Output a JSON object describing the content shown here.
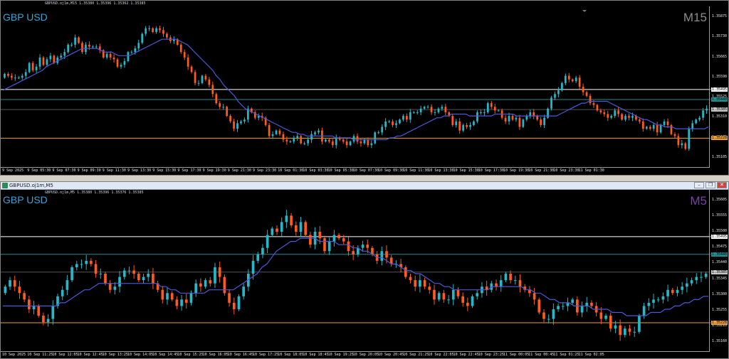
{
  "charts": [
    {
      "id": "m15",
      "window_title": "GBPUSD.oj1m,M15",
      "ohlc_text": "GBPUSD.oj1m,M15  1.35380 1.35396 1.35362 1.35385",
      "symbol": "GBP USD",
      "timeframe": "M15",
      "timeframe_color": "#8c8c8c",
      "price_labels": [
        "1.35875",
        "1.35730",
        "1.35665",
        "1.35590",
        "1.35525",
        "1.35310",
        "1.35175",
        "1.35105"
      ],
      "tags": [
        {
          "text": "1.35495",
          "bg": "#ffffff",
          "value": 1.35495
        },
        {
          "text": "1.35440",
          "bg": "#1f8f8f",
          "value": 1.3544
        },
        {
          "text": "1.35385",
          "bg": "#c8c8c8",
          "value": 1.35385
        },
        {
          "text": "1.35228",
          "bg": "#f0a030",
          "value": 1.35228
        }
      ],
      "time_labels": [
        "9 Sep 2025",
        "9 Sep 05:30",
        "9 Sep 07:30",
        "9 Sep 09:30",
        "9 Sep 11:30",
        "9 Sep 13:30",
        "9 Sep 15:30",
        "9 Sep 17:30",
        "9 Sep 19:30",
        "9 Sep 21:30",
        "9 Sep 23:30",
        "10 Sep 01:30",
        "10 Sep 03:30",
        "10 Sep 05:30",
        "10 Sep 07:30",
        "10 Sep 09:30",
        "10 Sep 11:30",
        "10 Sep 13:30",
        "10 Sep 15:30",
        "10 Sep 17:30",
        "10 Sep 19:30",
        "10 Sep 21:30",
        "10 Sep 23:30",
        "11 Sep 01:30"
      ],
      "chart_data": {
        "type": "candlestick",
        "ylim": [
          1.3507,
          1.3595
        ],
        "hlines": [
          {
            "value": 1.35495,
            "color": "#ffffff"
          },
          {
            "value": 1.3544,
            "color": "#1f8f8f"
          },
          {
            "value": 1.35385,
            "color": "#555555"
          },
          {
            "value": 1.35228,
            "color": "#f0a030"
          }
        ],
        "close": [
          1.3558,
          1.3557,
          1.3556,
          1.3556,
          1.3556,
          1.3557,
          1.3559,
          1.3564,
          1.356,
          1.3562,
          1.3567,
          1.3563,
          1.3566,
          1.3568,
          1.3564,
          1.3567,
          1.3568,
          1.357,
          1.3574,
          1.3574,
          1.3578,
          1.3575,
          1.357,
          1.3574,
          1.3573,
          1.3573,
          1.3573,
          1.3571,
          1.3567,
          1.3569,
          1.3567,
          1.3566,
          1.3562,
          1.3563,
          1.3565,
          1.357,
          1.357,
          1.3572,
          1.3575,
          1.358,
          1.3583,
          1.3583,
          1.3581,
          1.3583,
          1.3582,
          1.358,
          1.3578,
          1.3576,
          1.3577,
          1.3574,
          1.357,
          1.3567,
          1.3562,
          1.3559,
          1.3553,
          1.3553,
          1.3557,
          1.3555,
          1.3552,
          1.3547,
          1.3542,
          1.354,
          1.354,
          1.3535,
          1.3532,
          1.3528,
          1.3531,
          1.3532,
          1.3533,
          1.3539,
          1.3537,
          1.3534,
          1.3535,
          1.3534,
          1.353,
          1.3524,
          1.3525,
          1.3527,
          1.3525,
          1.3522,
          1.3521,
          1.3521,
          1.3523,
          1.3524,
          1.352,
          1.352,
          1.3522,
          1.3525,
          1.3526,
          1.3527,
          1.3521,
          1.3522,
          1.3521,
          1.3519,
          1.3523,
          1.3522,
          1.3521,
          1.3519,
          1.3521,
          1.3524,
          1.3521,
          1.352,
          1.3522,
          1.3519,
          1.352,
          1.3526,
          1.3526,
          1.3529,
          1.3532,
          1.3532,
          1.353,
          1.3531,
          1.3533,
          1.3535,
          1.3533,
          1.3537,
          1.3537,
          1.3537,
          1.3539,
          1.354,
          1.354,
          1.3537,
          1.3537,
          1.3539,
          1.354,
          1.3537,
          1.3535,
          1.353,
          1.3532,
          1.3527,
          1.353,
          1.3529,
          1.353,
          1.3532,
          1.3537,
          1.3537,
          1.3537,
          1.3542,
          1.354,
          1.3538,
          1.3538,
          1.3534,
          1.3532,
          1.3535,
          1.3533,
          1.3534,
          1.3529,
          1.3533,
          1.3535,
          1.3537,
          1.3535,
          1.3533,
          1.353,
          1.3534,
          1.3539,
          1.3545,
          1.3547,
          1.3549,
          1.3553,
          1.3557,
          1.3555,
          1.3554,
          1.3556,
          1.3551,
          1.3548,
          1.3546,
          1.3542,
          1.3541,
          1.3538,
          1.3537,
          1.3536,
          1.3534,
          1.3535,
          1.3538,
          1.3536,
          1.3533,
          1.3535,
          1.3534,
          1.3535,
          1.3533,
          1.3532,
          1.3528,
          1.3529,
          1.3528,
          1.353,
          1.3526,
          1.353,
          1.3532,
          1.353,
          1.3525,
          1.3524,
          1.3519,
          1.352,
          1.3517,
          1.3528,
          1.3531,
          1.3533,
          1.3534,
          1.3538,
          1.3539
        ],
        "ma": [
          1.3549,
          1.355,
          1.3551,
          1.3552,
          1.3553,
          1.3554,
          1.3555,
          1.3556,
          1.3557,
          1.3558,
          1.3559,
          1.356,
          1.3562,
          1.3563,
          1.3564,
          1.3565,
          1.3566,
          1.3567,
          1.3568,
          1.3569,
          1.357,
          1.3571,
          1.3572,
          1.3572,
          1.3572,
          1.3572,
          1.3572,
          1.3571,
          1.357,
          1.357,
          1.357,
          1.3569,
          1.3568,
          1.3568,
          1.3568,
          1.3568,
          1.3569,
          1.357,
          1.3571,
          1.3572,
          1.3573,
          1.3574,
          1.3575,
          1.3576,
          1.3577,
          1.3577,
          1.3577,
          1.3577,
          1.3577,
          1.3576,
          1.3575,
          1.3574,
          1.3572,
          1.357,
          1.3568,
          1.3566,
          1.3564,
          1.3562,
          1.356,
          1.3557,
          1.3555,
          1.3552,
          1.355,
          1.3548,
          1.3546,
          1.3543,
          1.3541,
          1.3539,
          1.3538,
          1.3537,
          1.3536,
          1.3535,
          1.3534,
          1.3533,
          1.3532,
          1.3531,
          1.353,
          1.3529,
          1.3528,
          1.3527,
          1.3526,
          1.3526,
          1.3525,
          1.3525,
          1.3524,
          1.3524,
          1.3524,
          1.3524,
          1.3524,
          1.3524,
          1.3524,
          1.3524,
          1.3523,
          1.3523,
          1.3523,
          1.3523,
          1.3523,
          1.3522,
          1.3522,
          1.3522,
          1.3522,
          1.3522,
          1.3522,
          1.3522,
          1.3522,
          1.3522,
          1.3522,
          1.3523,
          1.3523,
          1.3524,
          1.3524,
          1.3525,
          1.3526,
          1.3527,
          1.3528,
          1.3529,
          1.353,
          1.3531,
          1.3532,
          1.3533,
          1.3534,
          1.3534,
          1.3535,
          1.3535,
          1.3536,
          1.3536,
          1.3536,
          1.3536,
          1.3536,
          1.3535,
          1.3535,
          1.3535,
          1.3535,
          1.3535,
          1.3535,
          1.3535,
          1.3536,
          1.3536,
          1.3536,
          1.3536,
          1.3536,
          1.3536,
          1.3535,
          1.3535,
          1.3535,
          1.3535,
          1.3535,
          1.3535,
          1.3535,
          1.3535,
          1.3535,
          1.3535,
          1.3535,
          1.3535,
          1.3536,
          1.3537,
          1.3538,
          1.3539,
          1.354,
          1.3541,
          1.3542,
          1.3542,
          1.3543,
          1.3543,
          1.3543,
          1.3543,
          1.3543,
          1.3543,
          1.3542,
          1.3541,
          1.354,
          1.3539,
          1.3538,
          1.3537,
          1.3536,
          1.3535,
          1.3534,
          1.3533,
          1.3533,
          1.3532,
          1.3531,
          1.353,
          1.353,
          1.3529,
          1.3529,
          1.3529,
          1.3528,
          1.3528,
          1.3528,
          1.3528,
          1.3528,
          1.3528,
          1.3528,
          1.3528,
          1.3528,
          1.3529
        ]
      }
    },
    {
      "id": "m5",
      "window_title": "GBPUSD.oj1m,M5",
      "ohlc_text": "GBPUSD.oj1m,M5  1.35380 1.35396 1.35376 1.35385",
      "symbol": "GBP USD",
      "timeframe": "M5",
      "timeframe_color": "#7b3fb0",
      "price_labels": [
        "1.35605",
        "1.35555",
        "1.35500",
        "1.35475",
        "1.35440",
        "1.35345",
        "1.35300",
        "1.35255",
        "1.35210",
        "1.35160"
      ],
      "tags": [
        {
          "text": "1.35495",
          "bg": "#ffffff",
          "value": 1.35495
        },
        {
          "text": "1.35440",
          "bg": "#1f8f8f",
          "value": 1.3544
        },
        {
          "text": "1.35385",
          "bg": "#c8c8c8",
          "value": 1.35385
        },
        {
          "text": "1.35228",
          "bg": "#f0a030",
          "value": 1.35228
        }
      ],
      "time_labels": [
        "10 Sep 2025",
        "10 Sep 11:25",
        "10 Sep 12:05",
        "10 Sep 12:45",
        "10 Sep 13:25",
        "10 Sep 14:05",
        "10 Sep 14:45",
        "10 Sep 15:25",
        "10 Sep 16:05",
        "10 Sep 16:45",
        "10 Sep 17:25",
        "10 Sep 18:05",
        "10 Sep 18:45",
        "10 Sep 19:25",
        "10 Sep 20:05",
        "10 Sep 20:45",
        "10 Sep 21:25",
        "10 Sep 22:05",
        "10 Sep 22:45",
        "10 Sep 23:25",
        "11 Sep 00:05",
        "11 Sep 00:45",
        "11 Sep 01:25",
        "11 Sep 02:05"
      ],
      "chart_data": {
        "type": "candlestick",
        "ylim": [
          1.3514,
          1.3564
        ],
        "hlines": [
          {
            "value": 1.35495,
            "color": "#ffffff"
          },
          {
            "value": 1.3544,
            "color": "#1f8f8f"
          },
          {
            "value": 1.35385,
            "color": "#555555"
          },
          {
            "value": 1.35228,
            "color": "#f0a030"
          }
        ],
        "close": [
          1.3534,
          1.3536,
          1.3534,
          1.3532,
          1.353,
          1.3527,
          1.3528,
          1.3525,
          1.3523,
          1.3524,
          1.3528,
          1.3531,
          1.3533,
          1.3536,
          1.354,
          1.3541,
          1.3541,
          1.3542,
          1.3541,
          1.3538,
          1.3538,
          1.3535,
          1.3533,
          1.3534,
          1.3537,
          1.3539,
          1.3539,
          1.3538,
          1.3536,
          1.3537,
          1.3538,
          1.3535,
          1.3533,
          1.353,
          1.3532,
          1.353,
          1.3528,
          1.353,
          1.3529,
          1.3532,
          1.3535,
          1.3534,
          1.3536,
          1.3535,
          1.354,
          1.3537,
          1.3532,
          1.3529,
          1.3527,
          1.3531,
          1.3534,
          1.3538,
          1.3542,
          1.3544,
          1.3546,
          1.355,
          1.3552,
          1.3551,
          1.3554,
          1.3556,
          1.3553,
          1.3551,
          1.3554,
          1.355,
          1.3547,
          1.3551,
          1.3549,
          1.3545,
          1.3548,
          1.355,
          1.3549,
          1.3548,
          1.3545,
          1.3544,
          1.3546,
          1.3547,
          1.3546,
          1.3544,
          1.3542,
          1.3545,
          1.3543,
          1.3541,
          1.3541,
          1.354,
          1.3537,
          1.3536,
          1.3534,
          1.3536,
          1.3534,
          1.3533,
          1.353,
          1.3532,
          1.353,
          1.353,
          1.3533,
          1.3531,
          1.3529,
          1.3528,
          1.3531,
          1.3532,
          1.3534,
          1.3533,
          1.3535,
          1.3534,
          1.3536,
          1.3538,
          1.3536,
          1.3536,
          1.3534,
          1.3533,
          1.3532,
          1.353,
          1.3526,
          1.3524,
          1.3524,
          1.3527,
          1.3528,
          1.3528,
          1.3529,
          1.353,
          1.3526,
          1.3528,
          1.3529,
          1.3528,
          1.3526,
          1.3524,
          1.3525,
          1.3521,
          1.3522,
          1.3519,
          1.3521,
          1.352,
          1.352,
          1.3525,
          1.3528,
          1.3529,
          1.353,
          1.353,
          1.3531,
          1.3533,
          1.3532,
          1.3533,
          1.3534,
          1.3535,
          1.3536,
          1.3537,
          1.3537,
          1.3538
        ],
        "ma": [
          1.3528,
          1.3528,
          1.3528,
          1.3528,
          1.3528,
          1.3528,
          1.3528,
          1.3528,
          1.3528,
          1.3528,
          1.3528,
          1.3528,
          1.3529,
          1.3529,
          1.353,
          1.3531,
          1.3532,
          1.3533,
          1.3533,
          1.3534,
          1.3535,
          1.3535,
          1.3535,
          1.3535,
          1.3535,
          1.3535,
          1.3535,
          1.3535,
          1.3535,
          1.3535,
          1.3535,
          1.3535,
          1.3535,
          1.3534,
          1.3534,
          1.3533,
          1.3533,
          1.3532,
          1.3532,
          1.3532,
          1.3532,
          1.3532,
          1.3532,
          1.3533,
          1.3533,
          1.3533,
          1.3533,
          1.3533,
          1.3533,
          1.3534,
          1.3535,
          1.3536,
          1.3537,
          1.3538,
          1.354,
          1.3541,
          1.3543,
          1.3545,
          1.3546,
          1.3547,
          1.3548,
          1.3548,
          1.3549,
          1.3549,
          1.3549,
          1.3549,
          1.3548,
          1.3548,
          1.3548,
          1.3548,
          1.3547,
          1.3547,
          1.3547,
          1.3546,
          1.3546,
          1.3545,
          1.3545,
          1.3544,
          1.3543,
          1.3543,
          1.3542,
          1.3541,
          1.3541,
          1.354,
          1.3539,
          1.3539,
          1.3538,
          1.3538,
          1.3537,
          1.3536,
          1.3535,
          1.3535,
          1.3534,
          1.3534,
          1.3533,
          1.3533,
          1.3533,
          1.3533,
          1.3533,
          1.3533,
          1.3533,
          1.3533,
          1.3534,
          1.3534,
          1.3534,
          1.3534,
          1.3534,
          1.3534,
          1.3534,
          1.3533,
          1.3533,
          1.3532,
          1.3532,
          1.3531,
          1.353,
          1.353,
          1.3529,
          1.3529,
          1.3529,
          1.3528,
          1.3528,
          1.3528,
          1.3528,
          1.3527,
          1.3527,
          1.3527,
          1.3527,
          1.3526,
          1.3526,
          1.3526,
          1.3525,
          1.3525,
          1.3525,
          1.3525,
          1.3525,
          1.3526,
          1.3526,
          1.3526,
          1.3527,
          1.3527,
          1.3528,
          1.3528,
          1.3529,
          1.3529,
          1.353,
          1.353,
          1.3531,
          1.3531
        ]
      }
    }
  ]
}
